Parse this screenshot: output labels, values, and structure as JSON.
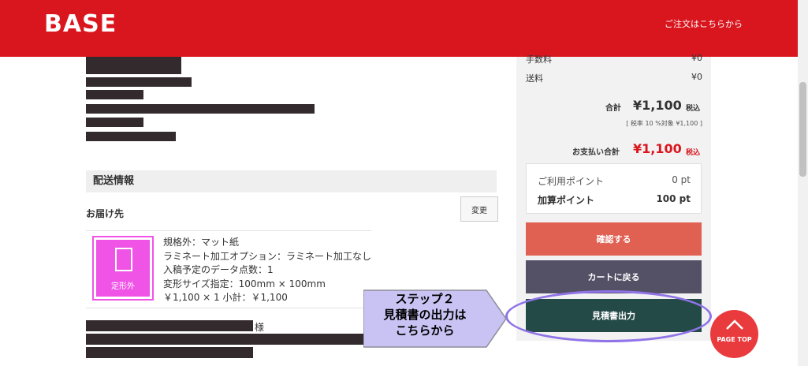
{
  "header": {
    "logo": "BASE",
    "order_link": "ご注文はこちらから"
  },
  "summary": {
    "fee_label": "手数料",
    "fee_value": "¥0",
    "shipping_label": "送料",
    "shipping_value": "¥0",
    "total_label": "合計",
    "total_amount": "¥1,100",
    "total_tax": "税込",
    "tax_note": "[ 税率 10 %対象 ¥1,100 ]",
    "payment_label": "お支払い合計",
    "payment_amount": "¥1,100",
    "payment_tax": "税込"
  },
  "points": {
    "used_label": "ご利用ポイント",
    "used_value": "0 pt",
    "added_label": "加算ポイント",
    "added_value": "100 pt"
  },
  "buttons": {
    "confirm": "確認する",
    "back_to_cart": "カートに戻る",
    "estimate": "見積書出力"
  },
  "shipping": {
    "section_title": "配送情報",
    "deliver_to": "お届け先",
    "change_button": "変更",
    "honorific": "様"
  },
  "item": {
    "thumbnail_label": "定形外",
    "lines": [
      "規格外：マット紙",
      "ラミネート加工オプション：ラミネート加工なし",
      "入稿予定のデータ点数：1",
      "変形サイズ指定：100mm × 100mm",
      "￥1,100 × 1  小計：￥1,100"
    ]
  },
  "callout": {
    "lines": [
      "ステップ２",
      "見積書の出力は",
      "こちらから"
    ]
  },
  "page_top": "PAGE TOP",
  "colors": {
    "brand_red": "#d9161e",
    "confirm_button": "#e06052",
    "cart_button": "#545166",
    "estimate_button": "#244a48",
    "highlight_ellipse": "#8f73e7",
    "callout_fill": "#c9c3f3",
    "thumbnail_pink": "#ef54e6"
  }
}
